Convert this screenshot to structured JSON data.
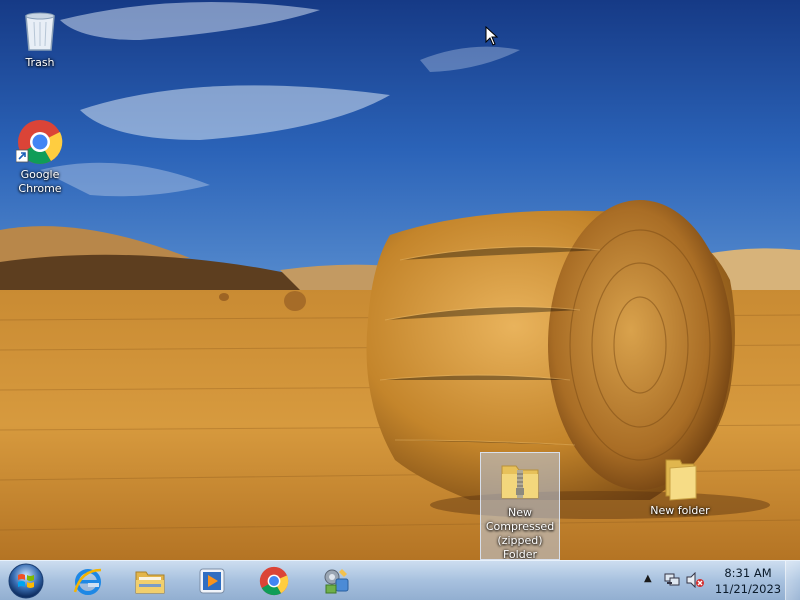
{
  "desktop": {
    "icons": [
      {
        "label": "Trash",
        "icon": "recycle-bin-icon"
      },
      {
        "label": "Google Chrome",
        "icon": "chrome-icon"
      },
      {
        "label": "New Compressed (zipped) Folder",
        "icon": "zip-folder-icon"
      },
      {
        "label": "New folder",
        "icon": "folder-icon"
      }
    ]
  },
  "taskbar": {
    "start": {
      "icon": "windows-start-icon"
    },
    "pinned": [
      {
        "icon": "internet-explorer-icon"
      },
      {
        "icon": "file-explorer-icon"
      },
      {
        "icon": "media-player-icon"
      },
      {
        "icon": "chrome-icon"
      },
      {
        "icon": "control-panel-icon"
      }
    ],
    "tray": {
      "up_arrow": "▲",
      "network_icon": "network-icon",
      "volume_icon": "volume-muted-icon",
      "time": "8:31 AM",
      "date": "11/21/2023"
    }
  },
  "colors": {
    "sky": "#1f4fa0",
    "field": "#c98a2c",
    "taskbar": "#a7c1df"
  }
}
